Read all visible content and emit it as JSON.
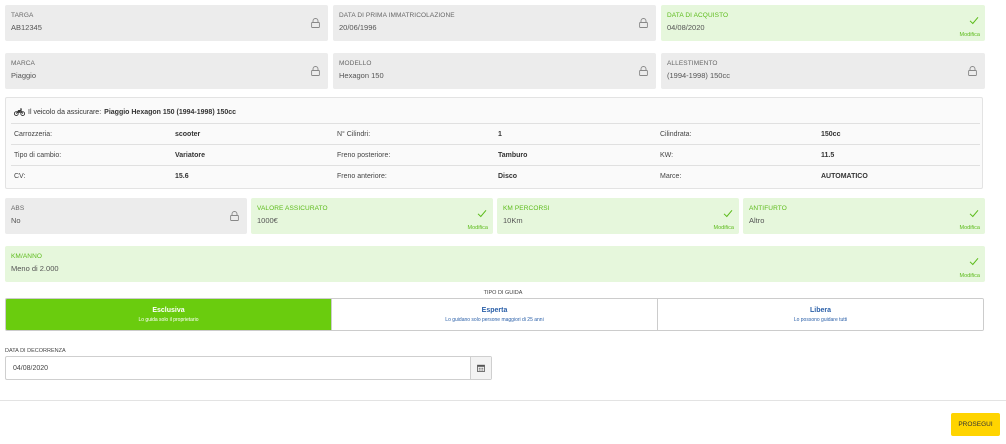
{
  "row1": [
    {
      "label": "TARGA",
      "value": "AB12345",
      "state": "locked"
    },
    {
      "label": "DATA DI PRIMA IMMATRICOLAZIONE",
      "value": "20/06/1996",
      "state": "locked"
    },
    {
      "label": "DATA DI ACQUISTO",
      "value": "04/08/2020",
      "state": "ok",
      "edit": "Modifica"
    }
  ],
  "row2": [
    {
      "label": "MARCA",
      "value": "Piaggio",
      "state": "locked"
    },
    {
      "label": "MODELLO",
      "value": "Hexagon 150",
      "state": "locked"
    },
    {
      "label": "ALLESTIMENTO",
      "value": "(1994-1998) 150cc",
      "state": "locked"
    }
  ],
  "vehicle": {
    "prefix": "Il veicolo da assicurare:",
    "name": "Piaggio Hexagon 150 (1994-1998) 150cc",
    "rows": [
      [
        "Carrozzeria:",
        "scooter",
        "N° Cilindri:",
        "1",
        "Cilindrata:",
        "150cc"
      ],
      [
        "Tipo di cambio:",
        "Variatore",
        "Freno posteriore:",
        "Tamburo",
        "KW:",
        "11.5"
      ],
      [
        "CV:",
        "15.6",
        "Freno anteriore:",
        "Disco",
        "Marce:",
        "AUTOMATICO"
      ]
    ]
  },
  "row3": [
    {
      "label": "ABS",
      "value": "No",
      "state": "locked"
    },
    {
      "label": "VALORE ASSICURATO",
      "value": "1000€",
      "state": "ok",
      "edit": "Modifica"
    },
    {
      "label": "KM PERCORSI",
      "value": "10Km",
      "state": "ok",
      "edit": "Modifica"
    },
    {
      "label": "ANTIFURTO",
      "value": "Altro",
      "state": "ok",
      "edit": "Modifica"
    }
  ],
  "kmanno": {
    "label": "KM/ANNO",
    "value": "Meno di 2.000",
    "edit": "Modifica"
  },
  "guide": {
    "label": "TIPO DI GUIDA",
    "options": [
      {
        "title": "Esclusiva",
        "desc": "Lo guida solo il proprietario",
        "active": true
      },
      {
        "title": "Esperta",
        "desc": "Lo guidano solo persone maggiori di 25 anni",
        "active": false
      },
      {
        "title": "Libera",
        "desc": "Lo possono guidare tutti",
        "active": false
      }
    ]
  },
  "decorrenza": {
    "label": "DATA DI DECORRENZA",
    "value": "04/08/2020"
  },
  "next_label": "PROSEGUI",
  "colors": {
    "accent_green": "#6acc0e",
    "ok_bg": "#e6f7dc",
    "locked_bg": "#ececec",
    "button_yellow": "#ffd400",
    "link_blue": "#2a5fa8"
  }
}
